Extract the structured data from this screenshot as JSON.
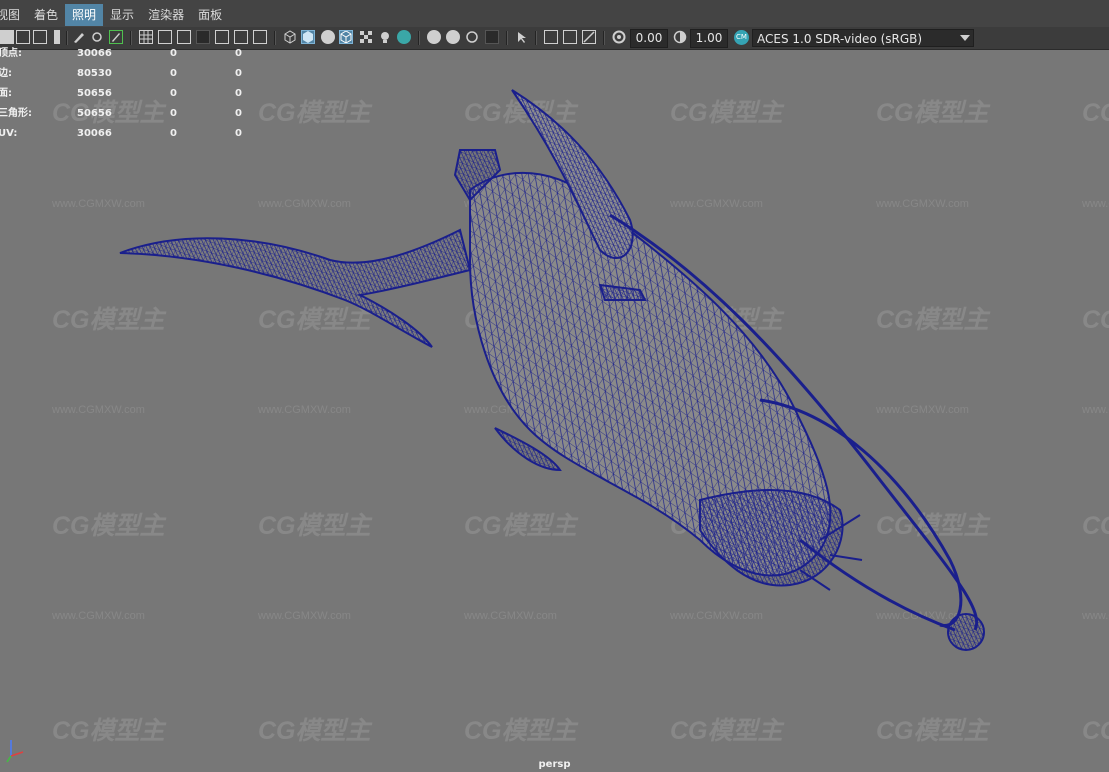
{
  "menu": {
    "items": [
      "视图",
      "着色",
      "照明",
      "显示",
      "渲染器",
      "面板"
    ],
    "active_index": 2,
    "accent_color": "#5285a6"
  },
  "toolbar": {
    "field_a": "0.00",
    "field_b": "1.00",
    "color_management": "ACES 1.0 SDR-video (sRGB)"
  },
  "hud": {
    "rows": [
      {
        "label": "顶点:",
        "v1": "30066",
        "v2": "0",
        "v3": "0"
      },
      {
        "label": "边:",
        "v1": "80530",
        "v2": "0",
        "v3": "0"
      },
      {
        "label": "面:",
        "v1": "50656",
        "v2": "0",
        "v3": "0"
      },
      {
        "label": "三角形:",
        "v1": "50656",
        "v2": "0",
        "v3": "0"
      },
      {
        "label": "UV:",
        "v1": "30066",
        "v2": "0",
        "v3": "0"
      }
    ]
  },
  "viewport": {
    "camera": "persp",
    "wireframe_color": "#1a1f8c",
    "background_color": "#777777"
  },
  "watermark": {
    "logo": "CG模型主",
    "url": "www.CGMXW.com"
  }
}
